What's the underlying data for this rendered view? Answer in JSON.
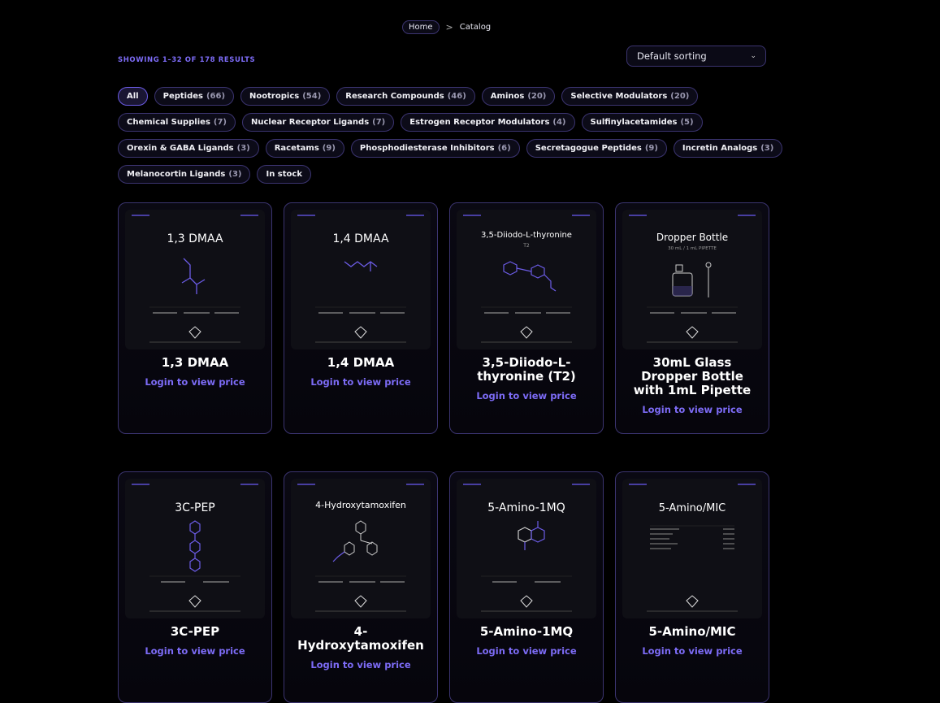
{
  "breadcrumb": {
    "home": "Home",
    "separator": ">",
    "current": "Catalog"
  },
  "results_text": "SHOWING 1–32 OF 178 RESULTS",
  "sort": {
    "selected": "Default sorting"
  },
  "filters": [
    [
      {
        "label": "All",
        "count": ""
      },
      {
        "label": "Peptides",
        "count": "(66)"
      },
      {
        "label": "Nootropics",
        "count": "(54)"
      },
      {
        "label": "Research Compounds",
        "count": "(46)"
      },
      {
        "label": "Aminos",
        "count": "(20)"
      },
      {
        "label": "Selective Modulators",
        "count": "(20)"
      }
    ],
    [
      {
        "label": "Chemical Supplies",
        "count": "(7)"
      },
      {
        "label": "Nuclear Receptor Ligands",
        "count": "(7)"
      },
      {
        "label": "Estrogen Receptor Modulators",
        "count": "(4)"
      },
      {
        "label": "Sulfinylacetamides",
        "count": "(5)"
      }
    ],
    [
      {
        "label": "Orexin & GABA Ligands",
        "count": "(3)"
      },
      {
        "label": "Racetams",
        "count": "(9)"
      },
      {
        "label": "Phosphodiesterase Inhibitors",
        "count": "(6)"
      },
      {
        "label": "Secretagogue Peptides",
        "count": "(9)"
      },
      {
        "label": "Incretin Analogs",
        "count": "(3)"
      }
    ],
    [
      {
        "label": "Melanocortin Ligands",
        "count": "(3)"
      },
      {
        "label": "In stock",
        "count": ""
      }
    ]
  ],
  "products": [
    {
      "name": "1,3 DMAA",
      "image_title": "1,3 DMAA",
      "price_label": "Login to view price"
    },
    {
      "name": "1,4 DMAA",
      "image_title": "1,4 DMAA",
      "price_label": "Login to view price"
    },
    {
      "name": "3,5-Diiodo-L-thyronine (T2)",
      "image_title": "3,5-Diiodo-L-thyronine",
      "image_sub": "T2",
      "price_label": "Login to view price"
    },
    {
      "name": "30mL Glass Dropper Bottle with 1mL Pipette",
      "image_title": "Dropper Bottle",
      "image_sub": "30 mL / 1 mL PIPETTE",
      "price_label": "Login to view price"
    },
    {
      "name": "3C-PEP",
      "image_title": "3C-PEP",
      "price_label": "Login to view price"
    },
    {
      "name": "4-Hydroxytamoxifen",
      "image_title": "4-Hydroxytamoxifen",
      "price_label": "Login to view price"
    },
    {
      "name": "5-Amino-1MQ",
      "image_title": "5-Amino-1MQ",
      "price_label": "Login to view price"
    },
    {
      "name": "5-Amino/MIC",
      "image_title": "5-Amino/MIC",
      "price_label": "Login to view price"
    }
  ],
  "colors": {
    "accent": "#7d6cf7",
    "border": "#3b3470",
    "background": "#000000"
  },
  "icons": {
    "sort": "chevron-down-icon",
    "brand": "gem-logo-icon"
  }
}
